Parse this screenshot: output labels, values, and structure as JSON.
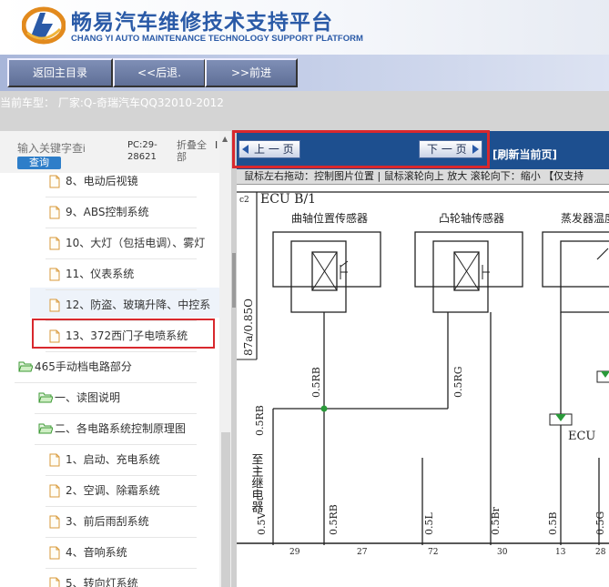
{
  "header": {
    "title": "畅易汽车维修技术支持平台",
    "subtitle": "CHANG YI AUTO MAINTENANCE TECHNOLOGY SUPPORT PLATFORM"
  },
  "toolbar": {
    "home_label": "返回主目录",
    "back_label": "<<后退.",
    "forward_label": ">>前进"
  },
  "model": {
    "text": "当前车型： 厂家:Q-奇瑞汽车QQ32010-2012"
  },
  "search": {
    "placeholder": "输入关键字查i",
    "button": "查询",
    "pc_label": "PC:29-28621",
    "fold_all": "折叠全部",
    "fold_mark": "I"
  },
  "tree": [
    {
      "label": "8、电动后视镜",
      "type": "file",
      "indent": 2
    },
    {
      "label": "9、ABS控制系统",
      "type": "file",
      "indent": 2
    },
    {
      "label": "10、大灯（包括电调）、雾灯",
      "type": "file",
      "indent": 2
    },
    {
      "label": "11、仪表系统",
      "type": "file",
      "indent": 2
    },
    {
      "label": "12、防盗、玻璃升降、中控系",
      "type": "file",
      "indent": 2
    },
    {
      "label": "13、372西门子电喷系统",
      "type": "file",
      "indent": 2,
      "selected": true
    },
    {
      "label": "465手动档电路部分",
      "type": "folder",
      "indent": 0
    },
    {
      "label": "一、读图说明",
      "type": "folder",
      "indent": 1
    },
    {
      "label": "二、各电路系统控制原理图",
      "type": "folder",
      "indent": 1
    },
    {
      "label": "1、启动、充电系统",
      "type": "file",
      "indent": 2
    },
    {
      "label": "2、空调、除霜系统",
      "type": "file",
      "indent": 2
    },
    {
      "label": "3、前后雨刮系统",
      "type": "file",
      "indent": 2
    },
    {
      "label": "4、音响系统",
      "type": "file",
      "indent": 2
    },
    {
      "label": "5、转向灯系统",
      "type": "file",
      "indent": 2
    }
  ],
  "viewer": {
    "prev_label": "上 一 页",
    "next_label": "下 一 页",
    "refresh_label": "[刷新当前页]",
    "hint": "鼠标左右拖动：控制图片位置 | 鼠标滚轮向上 放大  滚轮向下：缩小 【仅支持"
  },
  "diagram": {
    "corner_label": "c2",
    "ecu_label": "ECU B/1",
    "sensor1": "曲轴位置传感器",
    "sensor2": "凸轮轴传感器",
    "sensor3": "蒸发器温度",
    "ecu_small": "ECU",
    "v_label_1": "87a/0.85O",
    "wire_labels": [
      "0.5RB",
      "0.5RG",
      "0.5RB",
      "0.5V",
      "0.5RB",
      "0.5L",
      "0.5Br",
      "0.5B",
      "0.5G"
    ],
    "relay_text": "至主继电器",
    "pins": [
      "29",
      "27",
      "72",
      "30",
      "13",
      "28"
    ]
  },
  "colors": {
    "brand": "#2a5aa7",
    "nav_bar": "#1d4f8f",
    "highlight": "#d8282d",
    "search_button": "#2e7ec9"
  }
}
